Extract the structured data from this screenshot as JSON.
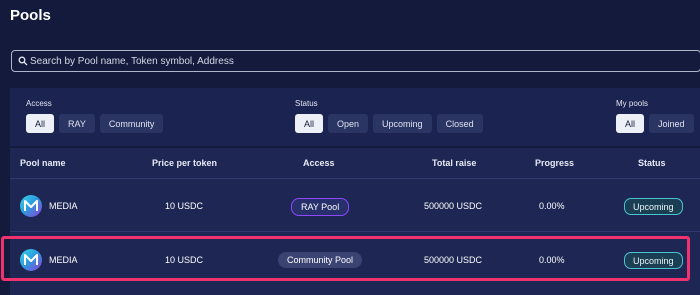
{
  "page": {
    "title": "Pools"
  },
  "search": {
    "placeholder": "Search by Pool name, Token symbol, Address"
  },
  "filters": {
    "access": {
      "label": "Access",
      "options": [
        "All",
        "RAY",
        "Community"
      ],
      "selected": "All"
    },
    "status": {
      "label": "Status",
      "options": [
        "All",
        "Open",
        "Upcoming",
        "Closed"
      ],
      "selected": "All"
    },
    "my_pools": {
      "label": "My pools",
      "options": [
        "All",
        "Joined"
      ],
      "selected": "All"
    }
  },
  "table": {
    "columns": [
      "Pool name",
      "Price per token",
      "Access",
      "Total raise",
      "Progress",
      "Status"
    ],
    "rows": [
      {
        "name": "MEDIA",
        "price": "10 USDC",
        "access": "RAY Pool",
        "raise": "500000 USDC",
        "progress": "0.00%",
        "status": "Upcoming"
      },
      {
        "name": "MEDIA",
        "price": "10 USDC",
        "access": "Community Pool",
        "raise": "500000 USDC",
        "progress": "0.00%",
        "status": "Upcoming"
      }
    ]
  },
  "icons": {
    "search": "search-icon",
    "pool_logo": "media-logo-icon"
  },
  "colors": {
    "background": "#131a3b",
    "panel": "#1b2350",
    "table": "#1e2754",
    "active_filter": "#edf0f7",
    "ray_pill_border": "#8f47ff",
    "status_border": "#4ac3cf",
    "highlight": "#f0336f"
  }
}
